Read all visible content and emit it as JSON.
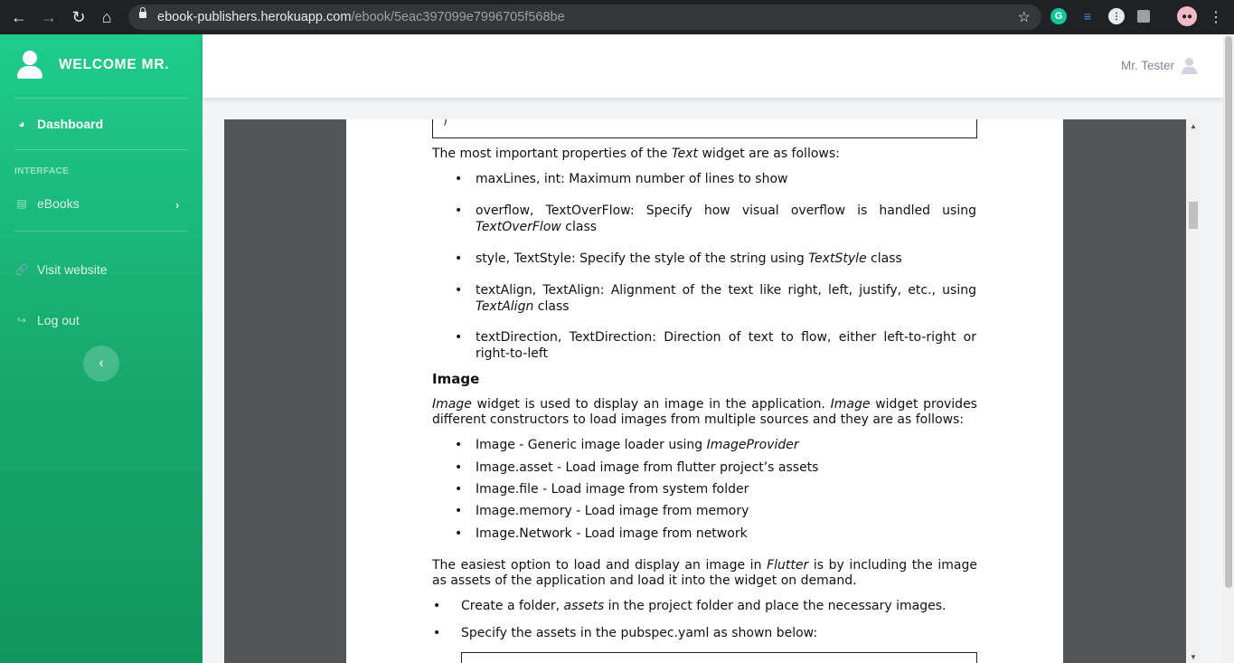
{
  "browser": {
    "url_host": "ebook-publishers.herokuapp.com",
    "url_path": "/ebook/5eac397099e7996705f568be"
  },
  "sidebar": {
    "brand": "WELCOME MR.",
    "dashboard": "Dashboard",
    "section_heading": "INTERFACE",
    "ebooks": "eBooks",
    "visit_website": "Visit website",
    "log_out": "Log out"
  },
  "topbar": {
    "user_name": "Mr. Tester"
  },
  "pdf": {
    "code_fragment": ")",
    "text_intro_a": "The most important properties of the ",
    "text_intro_em": "Text",
    "text_intro_b": " widget are as follows:",
    "text_props": [
      {
        "a": "maxLines, int: Maximum number of lines to show",
        "em": "",
        "b": ""
      },
      {
        "a": "overflow, TextOverFlow: Specify how visual overflow is handled using ",
        "em": "TextOverFlow",
        "b": " class"
      },
      {
        "a": "style, TextStyle: Specify the style of the string using ",
        "em": "TextStyle",
        "b": " class"
      },
      {
        "a": "textAlign, TextAlign: Alignment of the text like right, left, justify, etc., using ",
        "em": "TextAlign",
        "b": " class"
      },
      {
        "a": "textDirection, TextDirection: Direction of text to flow, either left-to-right or right-to-left",
        "em": "",
        "b": ""
      }
    ],
    "image_heading": "Image",
    "image_intro_em1": "Image",
    "image_intro_a": " widget is used to display an image in the application. ",
    "image_intro_em2": "Image",
    "image_intro_b": " widget provides different constructors to load images from multiple sources and they are as follows:",
    "image_items": [
      {
        "a": "Image - Generic image loader using ",
        "em": "ImageProvider"
      },
      {
        "a": "Image.asset - Load image from flutter project’s assets",
        "em": ""
      },
      {
        "a": "Image.file - Load image from system folder",
        "em": ""
      },
      {
        "a": "Image.memory - Load image from memory",
        "em": ""
      },
      {
        "a": "Image.Network - Load image from network",
        "em": ""
      }
    ],
    "easiest_a": "The easiest option to load and display an image in ",
    "easiest_em": "Flutter",
    "easiest_b": " is by including the image as assets of the application and load it into the widget on demand.",
    "steps": [
      {
        "a": "Create a folder, ",
        "em": "assets",
        "b": " in the project folder and place the necessary images."
      },
      {
        "a": "Specify the assets in the pubspec.yaml as shown below:",
        "em": "",
        "b": ""
      }
    ]
  }
}
